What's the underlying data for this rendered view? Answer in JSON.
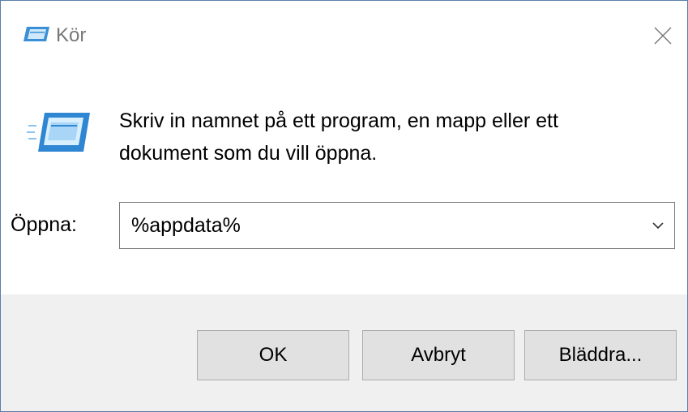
{
  "window": {
    "title": "Kör",
    "title_icon": "run-dialog-icon",
    "close_icon": "close-icon"
  },
  "content": {
    "icon": "run-dialog-icon",
    "description": "Skriv in namnet på ett program, en mapp eller ett dokument som du vill öppna."
  },
  "open_field": {
    "label": "Öppna:",
    "value": "%appdata%",
    "dropdown_icon": "chevron-down-icon"
  },
  "buttons": {
    "ok": "OK",
    "cancel": "Avbryt",
    "browse": "Bläddra..."
  },
  "colors": {
    "window_border": "#5a7fa8",
    "footer_bg": "#f0f0f0",
    "button_bg": "#e1e1e1",
    "button_border": "#adadad",
    "title_text": "#777777"
  }
}
